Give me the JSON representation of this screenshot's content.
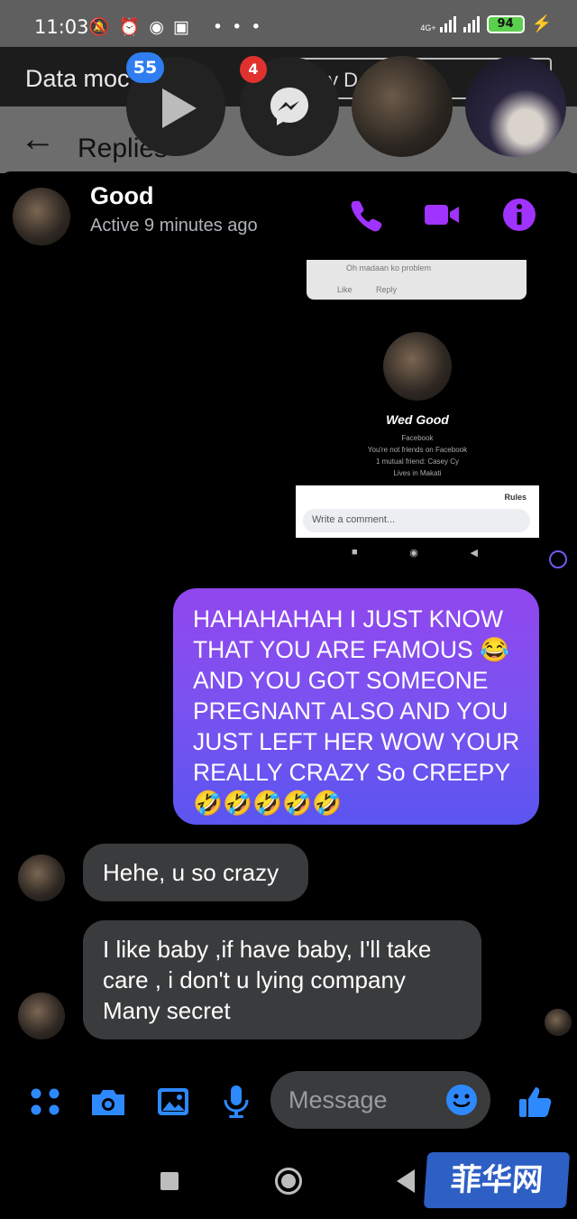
{
  "status_bar": {
    "time": "11:03",
    "icons": "🔕⏰◉▣ •••",
    "network_label": "4G+",
    "battery": "94"
  },
  "background_app": {
    "data_mode_label": "Data moc",
    "box_text": "y D       itch",
    "replies_label": "Replies"
  },
  "chat_heads": {
    "video_badge": "55",
    "messenger_badge": "4"
  },
  "conversation": {
    "contact_name": "Good",
    "active_status": "Active 9 minutes ago"
  },
  "shared_screenshot": {
    "card_line1": "Oh madaan ko problem",
    "card_line2": "Like Reply",
    "profile_name": "Wed Good",
    "platform": "Facebook",
    "line_friends": "You're not friends on Facebook",
    "line_mutual": "1 mutual friend: Casey Cy",
    "line_lives": "Lives in Makati",
    "rules": "Rules",
    "comment_placeholder": "Write a comment..."
  },
  "messages": [
    {
      "direction": "outgoing",
      "text": "HAHAHAHAH I JUST KNOW THAT YOU ARE FAMOUS 😂 AND YOU GOT SOMEONE PREGNANT ALSO AND YOU JUST LEFT HER WOW YOUR REALLY CRAZY So CREEPY 🤣🤣🤣🤣🤣"
    },
    {
      "direction": "incoming",
      "text": "Hehe, u so crazy"
    },
    {
      "direction": "incoming",
      "text": "I like baby  ,if have baby, I'll take care , i don't u lying company Many secret"
    }
  ],
  "composer": {
    "placeholder": "Message"
  },
  "watermark": "菲华网",
  "colors": {
    "accent_purple": "#a033ff",
    "accent_blue": "#2e89ff",
    "bubble_out_top": "#9147ee",
    "bubble_out_bottom": "#5b55f0",
    "bubble_in": "#3a3b3c",
    "badge_blue": "#2f7df0",
    "badge_red": "#e0312f"
  },
  "icons": [
    "mute-icon",
    "alarm-icon",
    "record-icon",
    "instagram-icon",
    "play-icon",
    "messenger-icon",
    "phone-icon",
    "video-camera-icon",
    "info-icon",
    "apps-icon",
    "camera-icon",
    "gallery-icon",
    "microphone-icon",
    "emoji-icon",
    "like-icon"
  ]
}
